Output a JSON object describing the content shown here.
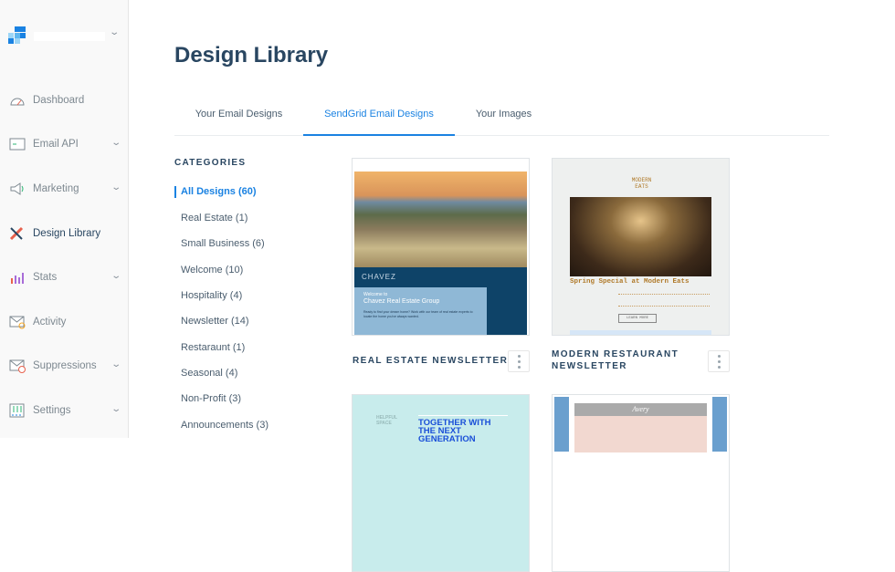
{
  "sidebar": {
    "items": [
      {
        "label": "Dashboard",
        "icon": "dashboard-gauge-icon"
      },
      {
        "label": "Email API",
        "icon": "terminal-icon",
        "expandable": true
      },
      {
        "label": "Marketing",
        "icon": "megaphone-icon",
        "expandable": true
      },
      {
        "label": "Design Library",
        "icon": "pencil-ruler-icon",
        "active": true
      },
      {
        "label": "Stats",
        "icon": "bar-chart-icon",
        "expandable": true
      },
      {
        "label": "Activity",
        "icon": "mail-search-icon"
      },
      {
        "label": "Suppressions",
        "icon": "mail-blocked-icon",
        "expandable": true
      },
      {
        "label": "Settings",
        "icon": "sliders-icon",
        "expandable": true
      }
    ]
  },
  "page_title": "Design Library",
  "tabs": [
    "Your Email Designs",
    "SendGrid Email Designs",
    "Your Images"
  ],
  "categories": {
    "heading": "CATEGORIES",
    "items": [
      "All Designs (60)",
      "Real Estate (1)",
      "Small Business (6)",
      "Welcome (10)",
      "Hospitality (4)",
      "Newsletter (14)",
      "Restaraunt (1)",
      "Seasonal (4)",
      "Non-Profit (3)",
      "Announcements (3)"
    ]
  },
  "designs": [
    {
      "title": "REAL ESTATE NEWSLETTER",
      "preview": {
        "brand": "CHAVEZ",
        "welcome": "Welcome to",
        "headline": "Chavez Real Estate Group",
        "body": "Ready to find your dream home? Work with our team of real estate experts to locate the home you've always wanted."
      }
    },
    {
      "title": "MODERN RESTAURANT NEWSLETTER",
      "preview": {
        "brand": "MODERN EATS",
        "headline": "Spring Special at Modern Eats",
        "cta": "LEARN MORE"
      }
    },
    {
      "title": "",
      "preview": {
        "brand": "HELPFUL SPACE",
        "headline": "TOGETHER WITH THE NEXT GENERATION"
      }
    },
    {
      "title": "",
      "preview": {
        "brand": "Avery"
      }
    }
  ],
  "colors": {
    "accent": "#1a82e2",
    "navy": "#294661"
  }
}
